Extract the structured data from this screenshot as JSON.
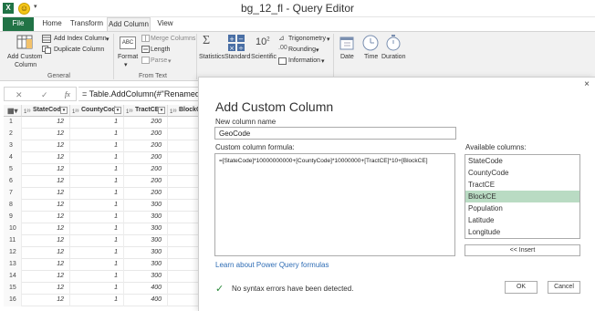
{
  "window": {
    "title": "bg_12_fl - Query Editor",
    "app_logo_text": "X",
    "qat_caret": "▾"
  },
  "tabs": [
    {
      "label": "File"
    },
    {
      "label": "Home"
    },
    {
      "label": "Transform"
    },
    {
      "label": "Add Column"
    },
    {
      "label": "View"
    }
  ],
  "ribbon": {
    "add_custom_column_line1": "Add Custom",
    "add_custom_column_line2": "Column",
    "add_index_column": "Add Index Column",
    "duplicate_column": "Duplicate Column",
    "group_general": "General",
    "format": "Format",
    "merge_columns": "Merge Columns",
    "length": "Length",
    "parse": "Parse",
    "group_from_text": "From Text",
    "statistics": "Statistics",
    "standard": "Standard",
    "scientific": "Scientific",
    "trigonometry": "Trigonometry",
    "rounding": "Rounding",
    "information": "Information",
    "date": "Date",
    "time": "Time",
    "duration": "Duration",
    "abc_text": "ABC",
    "ten_text": "10"
  },
  "formula_bar": {
    "cancel_glyph": "✕",
    "confirm_glyph": "✓",
    "fx_label": "fx",
    "formula": "= Table.AddColumn(#\"Renamed C"
  },
  "grid": {
    "headers": [
      "StateCode",
      "CountyCode",
      "TractCE",
      "BlockCE"
    ],
    "header_type_icon": "1²³",
    "rows": [
      {
        "n": "1",
        "state": "12",
        "county": "1",
        "tract": "200"
      },
      {
        "n": "2",
        "state": "12",
        "county": "1",
        "tract": "200"
      },
      {
        "n": "3",
        "state": "12",
        "county": "1",
        "tract": "200"
      },
      {
        "n": "4",
        "state": "12",
        "county": "1",
        "tract": "200"
      },
      {
        "n": "5",
        "state": "12",
        "county": "1",
        "tract": "200"
      },
      {
        "n": "6",
        "state": "12",
        "county": "1",
        "tract": "200"
      },
      {
        "n": "7",
        "state": "12",
        "county": "1",
        "tract": "200"
      },
      {
        "n": "8",
        "state": "12",
        "county": "1",
        "tract": "300"
      },
      {
        "n": "9",
        "state": "12",
        "county": "1",
        "tract": "300"
      },
      {
        "n": "10",
        "state": "12",
        "county": "1",
        "tract": "300"
      },
      {
        "n": "11",
        "state": "12",
        "county": "1",
        "tract": "300"
      },
      {
        "n": "12",
        "state": "12",
        "county": "1",
        "tract": "300"
      },
      {
        "n": "13",
        "state": "12",
        "county": "1",
        "tract": "300"
      },
      {
        "n": "14",
        "state": "12",
        "county": "1",
        "tract": "300"
      },
      {
        "n": "15",
        "state": "12",
        "county": "1",
        "tract": "400"
      },
      {
        "n": "16",
        "state": "12",
        "county": "1",
        "tract": "400"
      }
    ]
  },
  "dialog": {
    "close_glyph": "×",
    "title": "Add Custom Column",
    "new_column_name_label": "New column name",
    "new_column_name_value": "GeoCode",
    "formula_label": "Custom column formula:",
    "formula_value": "=[StateCode]*10000000000+[CountyCode]*10000000+[TractCE]*10+[BlockCE]",
    "available_columns_label": "Available columns:",
    "available_columns": [
      "StateCode",
      "CountyCode",
      "TractCE",
      "BlockCE",
      "Population",
      "Latitude",
      "Longitude"
    ],
    "selected_column": "BlockCE",
    "insert_label": "<< Insert",
    "learn_link": "Learn about Power Query formulas",
    "status_glyph": "✓",
    "status_text": "No syntax errors have been detected.",
    "ok_label": "OK",
    "cancel_label": "Cancel"
  },
  "colors": {
    "excel_green": "#217346",
    "selection_green": "#b9dbc3",
    "link_blue": "#2f6db5",
    "success_green": "#2a8a3a"
  }
}
